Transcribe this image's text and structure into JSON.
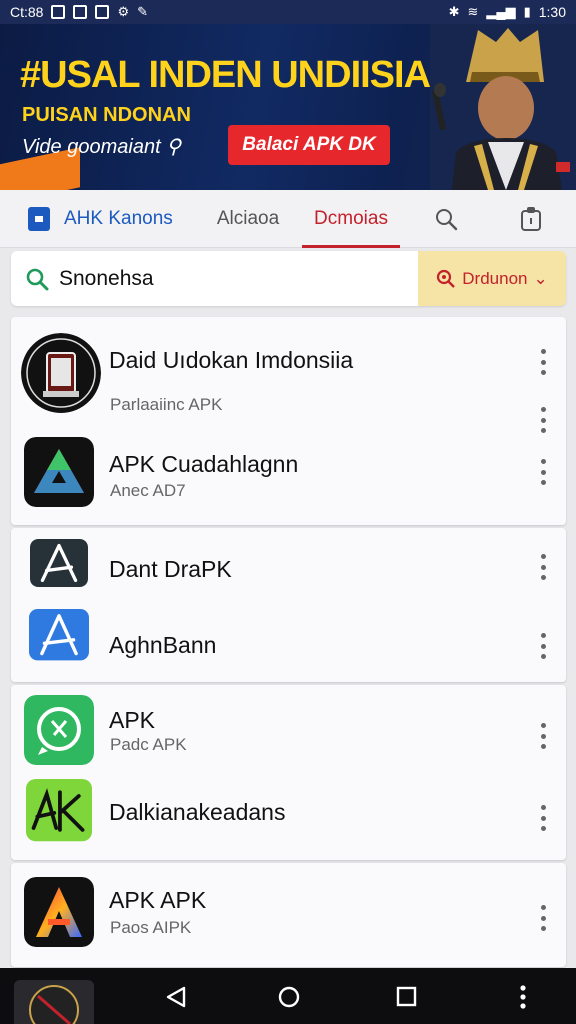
{
  "status_bar": {
    "time_left": "Ct:88",
    "time_right": "1:30"
  },
  "banner": {
    "title": "#USAL INDEN UNDIISIAN",
    "subtitle": "PUISAN NDONAN",
    "note": "Vide goomaiant",
    "cta_label": "Balaci APK DK",
    "accent": "#ffd21c",
    "cta_color": "#e6282d"
  },
  "tabs": [
    {
      "label": "AHK Kanons"
    },
    {
      "label": "Alciaoa"
    },
    {
      "label": "Dcmoias"
    }
  ],
  "search": {
    "value": "Snonehsa",
    "sort_label": "Drdunon"
  },
  "apps": [
    {
      "name": "Daid Uıdokan Imdonsiia",
      "sub": "Parlaaiinc APK",
      "icon": "phone-seal-icon"
    },
    {
      "name": "APK Cuadahlagnn",
      "sub": "Anec AD7",
      "icon": "triangle-logo-icon"
    },
    {
      "name": "Dant DraPK",
      "sub": "",
      "icon": "app-store-a-icon"
    },
    {
      "name": "AghnBann",
      "sub": "",
      "icon": "app-store-a-icon"
    },
    {
      "name": "APK",
      "sub": "Padc APK",
      "icon": "chat-bubble-icon"
    },
    {
      "name": "Dalkianakeadans",
      "sub": "",
      "icon": "ak-letters-icon"
    },
    {
      "name": "APK  APK",
      "sub": "Paos AIPK",
      "icon": "gradient-a-icon"
    }
  ],
  "colors": {
    "status_bg": "#1c2a57",
    "tab_active": "#c3222c",
    "tab_home": "#1d5ac0",
    "sort_bg": "#f6e3a6"
  }
}
